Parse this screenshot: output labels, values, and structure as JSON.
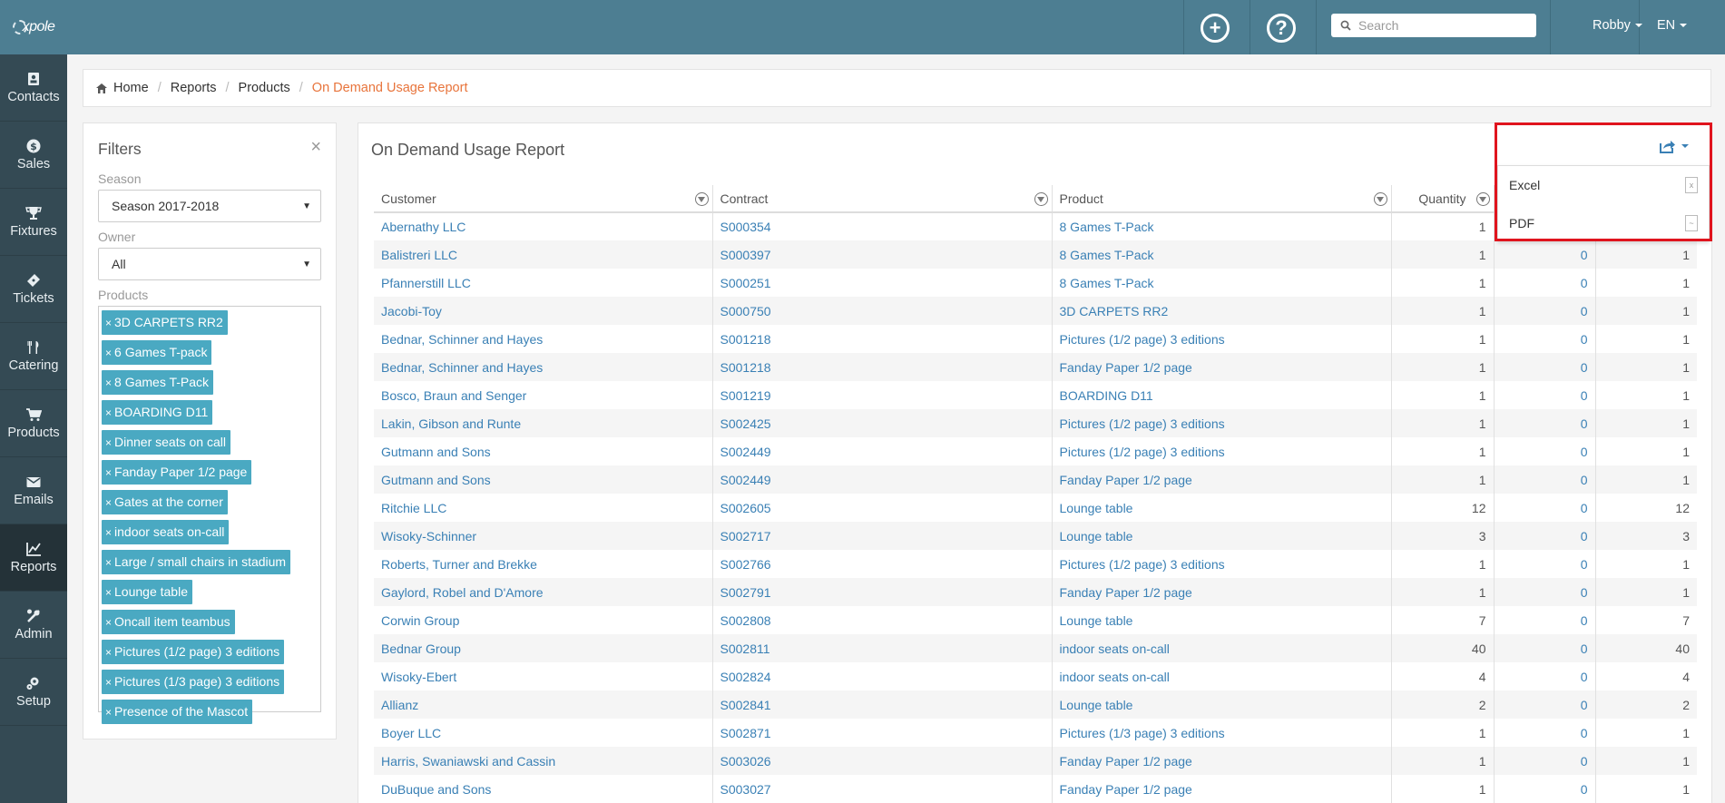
{
  "app": {
    "logo_text": "xpole"
  },
  "sidebar": {
    "items": [
      {
        "label": "Contacts",
        "icon": "contacts-icon"
      },
      {
        "label": "Sales",
        "icon": "dollar-icon"
      },
      {
        "label": "Fixtures",
        "icon": "trophy-icon"
      },
      {
        "label": "Tickets",
        "icon": "ticket-icon"
      },
      {
        "label": "Catering",
        "icon": "cutlery-icon"
      },
      {
        "label": "Products",
        "icon": "cart-icon"
      },
      {
        "label": "Emails",
        "icon": "envelope-icon"
      },
      {
        "label": "Reports",
        "icon": "chart-icon",
        "active": true
      },
      {
        "label": "Admin",
        "icon": "tools-icon"
      },
      {
        "label": "Setup",
        "icon": "gears-icon"
      }
    ]
  },
  "topbar": {
    "add_icon": "plus-circle-icon",
    "help_icon": "question-circle-icon",
    "search_placeholder": "Search",
    "user": "Robby",
    "language": "EN"
  },
  "breadcrumb": {
    "home": "Home",
    "items": [
      "Reports",
      "Products"
    ],
    "current": "On Demand Usage Report"
  },
  "filters": {
    "title": "Filters",
    "close": "×",
    "season_label": "Season",
    "season_value": "Season 2017-2018",
    "owner_label": "Owner",
    "owner_value": "All",
    "products_label": "Products",
    "products": [
      "3D CARPETS RR2",
      "6 Games T-pack",
      "8 Games T-Pack",
      "BOARDING D11",
      "Dinner seats on call",
      "Fanday Paper 1/2 page",
      "Gates at the corner",
      "indoor seats on-call",
      "Large / small chairs in stadium",
      "Lounge table",
      "Oncall item teambus",
      "Pictures (1/2 page) 3 editions",
      "Pictures (1/3 page) 3 editions",
      "Presence of the Mascot"
    ]
  },
  "report": {
    "title": "On Demand Usage Report",
    "columns": [
      "Customer",
      "Contract",
      "Product",
      "Quantity"
    ],
    "rows": [
      [
        "Abernathy LLC",
        "S000354",
        "8 Games T-Pack",
        "1",
        "",
        ""
      ],
      [
        "Balistreri LLC",
        "S000397",
        "8 Games T-Pack",
        "1",
        "0",
        "1"
      ],
      [
        "Pfannerstill LLC",
        "S000251",
        "8 Games T-Pack",
        "1",
        "0",
        "1"
      ],
      [
        "Jacobi-Toy",
        "S000750",
        "3D CARPETS RR2",
        "1",
        "0",
        "1"
      ],
      [
        "Bednar, Schinner and Hayes",
        "S001218",
        "Pictures (1/2 page) 3 editions",
        "1",
        "0",
        "1"
      ],
      [
        "Bednar, Schinner and Hayes",
        "S001218",
        "Fanday Paper 1/2 page",
        "1",
        "0",
        "1"
      ],
      [
        "Bosco, Braun and Senger",
        "S001219",
        "BOARDING D11",
        "1",
        "0",
        "1"
      ],
      [
        "Lakin, Gibson and Runte",
        "S002425",
        "Pictures (1/2 page) 3 editions",
        "1",
        "0",
        "1"
      ],
      [
        "Gutmann and Sons",
        "S002449",
        "Pictures (1/2 page) 3 editions",
        "1",
        "0",
        "1"
      ],
      [
        "Gutmann and Sons",
        "S002449",
        "Fanday Paper 1/2 page",
        "1",
        "0",
        "1"
      ],
      [
        "Ritchie LLC",
        "S002605",
        "Lounge table",
        "12",
        "0",
        "12"
      ],
      [
        "Wisoky-Schinner",
        "S002717",
        "Lounge table",
        "3",
        "0",
        "3"
      ],
      [
        "Roberts, Turner and Brekke",
        "S002766",
        "Pictures (1/2 page) 3 editions",
        "1",
        "0",
        "1"
      ],
      [
        "Gaylord, Robel and D'Amore",
        "S002791",
        "Fanday Paper 1/2 page",
        "1",
        "0",
        "1"
      ],
      [
        "Corwin Group",
        "S002808",
        "Lounge table",
        "7",
        "0",
        "7"
      ],
      [
        "Bednar Group",
        "S002811",
        "indoor seats on-call",
        "40",
        "0",
        "40"
      ],
      [
        "Wisoky-Ebert",
        "S002824",
        "indoor seats on-call",
        "4",
        "0",
        "4"
      ],
      [
        "Allianz",
        "S002841",
        "Lounge table",
        "2",
        "0",
        "2"
      ],
      [
        "Boyer LLC",
        "S002871",
        "Pictures (1/3 page) 3 editions",
        "1",
        "0",
        "1"
      ],
      [
        "Harris, Swaniawski and Cassin",
        "S003026",
        "Fanday Paper 1/2 page",
        "1",
        "0",
        "1"
      ],
      [
        "DuBuque and Sons",
        "S003027",
        "Fanday Paper 1/2 page",
        "1",
        "0",
        "1"
      ]
    ]
  },
  "export": {
    "icon": "share-export-icon",
    "options": [
      {
        "label": "Excel",
        "icon": "file-excel-icon"
      },
      {
        "label": "PDF",
        "icon": "file-pdf-icon"
      }
    ],
    "highlight_color": "#e0141e"
  }
}
